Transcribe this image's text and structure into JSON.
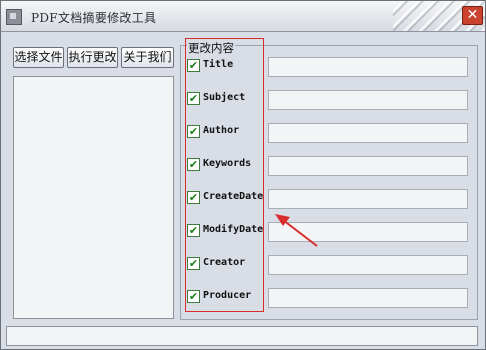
{
  "window": {
    "title": "PDF文档摘要修改工具",
    "close_glyph": "✕"
  },
  "toolbar": {
    "select_file_label": "选择文件",
    "execute_label": "执行更改",
    "about_label": "关于我们"
  },
  "fields_group": {
    "title": "更改内容",
    "fields": [
      {
        "label": "Title",
        "checked": true,
        "value": ""
      },
      {
        "label": "Subject",
        "checked": true,
        "value": ""
      },
      {
        "label": "Author",
        "checked": true,
        "value": ""
      },
      {
        "label": "Keywords",
        "checked": true,
        "value": ""
      },
      {
        "label": "CreateDate",
        "checked": true,
        "value": ""
      },
      {
        "label": "ModifyDate",
        "checked": true,
        "value": ""
      },
      {
        "label": "Creator",
        "checked": true,
        "value": ""
      },
      {
        "label": "Producer",
        "checked": true,
        "value": ""
      }
    ]
  },
  "check_glyph": "✔",
  "colors": {
    "annotation": "#d92d2d",
    "checkbox": "#1a7f1a"
  }
}
